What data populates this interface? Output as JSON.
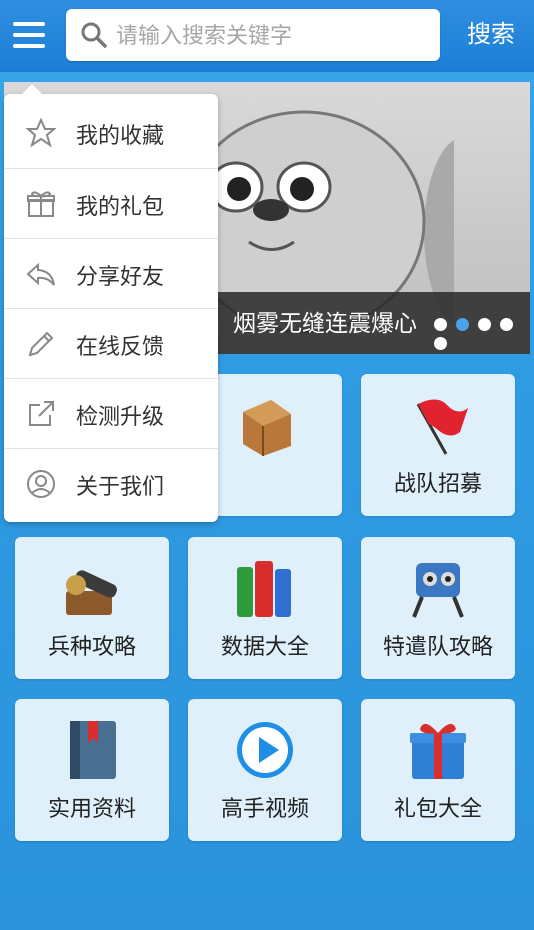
{
  "header": {
    "search_placeholder": "请输入搜索关键字",
    "search_button": "搜索"
  },
  "banner": {
    "caption": "」烟雾无缝连震爆心",
    "dot_count": 5,
    "active_dot": 1
  },
  "menu": {
    "items": [
      {
        "label": "我的收藏",
        "icon": "star-icon"
      },
      {
        "label": "我的礼包",
        "icon": "gift-icon"
      },
      {
        "label": "分享好友",
        "icon": "share-icon"
      },
      {
        "label": "在线反馈",
        "icon": "pencil-icon"
      },
      {
        "label": "检测升级",
        "icon": "external-link-icon"
      },
      {
        "label": "关于我们",
        "icon": "user-icon"
      }
    ]
  },
  "grid": {
    "tiles": [
      {
        "label": "",
        "icon": "crate-icon"
      },
      {
        "label": "战队招募",
        "icon": "red-flag-icon"
      },
      {
        "label": "兵种攻略",
        "icon": "cannon-icon"
      },
      {
        "label": "数据大全",
        "icon": "books-icon"
      },
      {
        "label": "特遣队攻略",
        "icon": "robot-icon"
      },
      {
        "label": "实用资料",
        "icon": "notebook-icon"
      },
      {
        "label": "高手视频",
        "icon": "play-icon"
      },
      {
        "label": "礼包大全",
        "icon": "gift-box-icon"
      }
    ]
  },
  "colors": {
    "top_bar": "#1c7fd6",
    "tile_bg": "#dff0fb",
    "dot_active": "#4aa3ea"
  }
}
